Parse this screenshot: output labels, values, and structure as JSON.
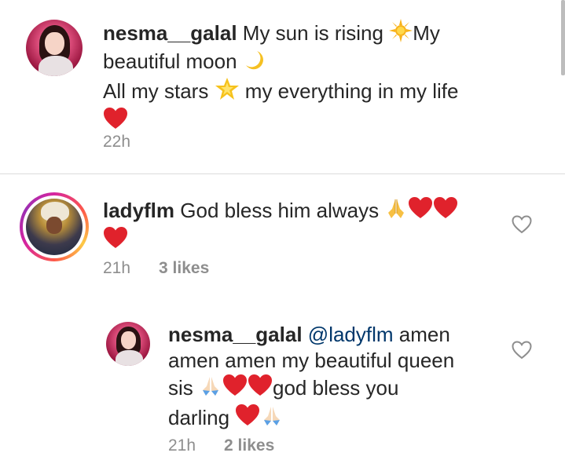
{
  "comments": [
    {
      "username": "nesma__galal",
      "line1": "My sun is rising ",
      "line1b": "My",
      "line2": "beautiful moon ",
      "line3a": "All my stars ",
      "line3b": " my everything in my life",
      "time": "22h"
    },
    {
      "username": "ladyflm",
      "text": "God bless him always ",
      "time": "21h",
      "likes": "3 likes"
    },
    {
      "username": "nesma__galal",
      "mention": "@ladyflm",
      "text1": " amen",
      "text2": "amen amen my beautiful queen",
      "text3a": "sis ",
      "text3b": "god bless you",
      "text4": "darling ",
      "time": "21h",
      "likes": "2 likes"
    }
  ],
  "icons": {
    "sun": "sun-emoji",
    "moon": "crescent-moon-emoji",
    "star": "glowing-star-emoji",
    "heart": "red-heart-emoji",
    "pray": "folded-hands-emoji",
    "like": "heart-outline-icon"
  },
  "colors": {
    "text": "#262626",
    "meta": "#8e8e8e",
    "mention": "#00376b",
    "heart": "#e0222c",
    "divider": "#dbdbdb"
  }
}
